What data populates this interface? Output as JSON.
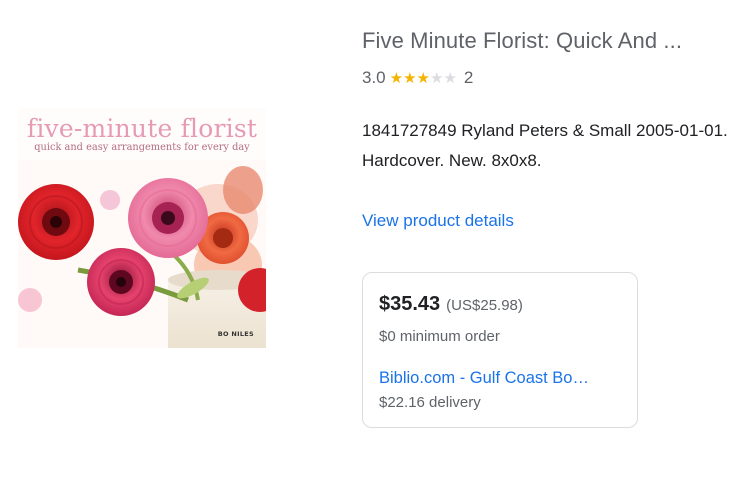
{
  "product": {
    "title": "Five Minute Florist: Quick And ...",
    "rating": "3.0",
    "stars": {
      "value": 3,
      "max": 5
    },
    "review_count": "2",
    "description": "1841727849 Ryland Peters & Small 2005-01-01. Hardcover. New. 8x0x8.",
    "details_link": "View product details"
  },
  "cover": {
    "title": "five-minute florist",
    "subtitle": "quick and easy arrangements for every day",
    "author": "BO NILES"
  },
  "offer": {
    "price": "$35.43",
    "price_alt": "(US$25.98)",
    "min_order": "$0 minimum order",
    "seller": "Biblio.com - Gulf Coast Bo…",
    "delivery": "$22.16 delivery"
  },
  "colors": {
    "link": "#1a73e8",
    "star": "#f4b400",
    "muted_text": "#5f6368"
  }
}
